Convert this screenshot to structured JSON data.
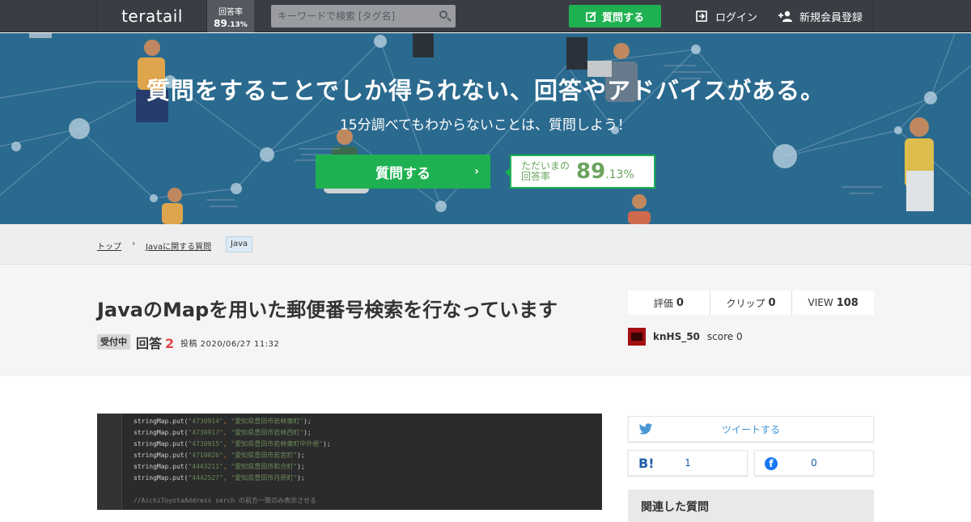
{
  "header": {
    "logo": "teratail",
    "rate_label": "回答率",
    "rate_value": "89",
    "rate_decimal": ".13%",
    "search_placeholder": "キーワードで検索 [タグ名]",
    "ask_label": "質問する",
    "login_label": "ログイン",
    "signup_label": "新規会員登録"
  },
  "hero": {
    "title": "質問をすることでしか得られない、回答やアドバイスがある。",
    "subtitle": "15分調べてもわからないことは、質問しよう！",
    "ask_label": "質問する",
    "rate_label_line1": "ただいまの",
    "rate_label_line2": "回答率",
    "rate_value": "89",
    "rate_decimal": ".13%"
  },
  "breadcrumb": {
    "items": [
      "トップ",
      "Javaに関する質問"
    ],
    "separator": "›",
    "tag": "Java"
  },
  "question": {
    "title": "JavaのMapを用いた郵便番号検索を行なっています",
    "status": "受付中",
    "answers_label": "回答",
    "answers_count": "2",
    "posted": "投稿 2020/06/27 11:32"
  },
  "stats": {
    "rating_label": "評価",
    "rating_value": "0",
    "clip_label": "クリップ",
    "clip_value": "0",
    "view_label": "VIEW",
    "view_value": "108"
  },
  "user": {
    "name": "knHS_50",
    "score_label": "score",
    "score_value": "0"
  },
  "share": {
    "tweet_label": "ツイートする",
    "hatena_count": "1",
    "facebook_count": "0"
  },
  "related": {
    "title": "関連した質問"
  },
  "code": {
    "lines": [
      {
        "key": "\"4730914\"",
        "val": "\"愛知県豊田市若林東町\""
      },
      {
        "key": "\"4730917\"",
        "val": "\"愛知県豊田市若林西町\""
      },
      {
        "key": "\"4730915\"",
        "val": "\"愛知県豊田市若林東町中外根\""
      },
      {
        "key": "\"4710026\"",
        "val": "\"愛知県豊田市若宮町\""
      },
      {
        "key": "\"4443211\"",
        "val": "\"愛知県豊田市和合町\""
      },
      {
        "key": "\"4442527\"",
        "val": "\"愛知県豊田市月原町\""
      }
    ],
    "call": "stringMap.put(",
    "comment": "//AichiToyotaAddress serch の前方一致のみ表示させる"
  },
  "colors": {
    "header_bg": "#3a3d44",
    "hero_bg": "#2b6a8f",
    "accent_green": "#1fb151",
    "answers_red": "#e0454b"
  }
}
